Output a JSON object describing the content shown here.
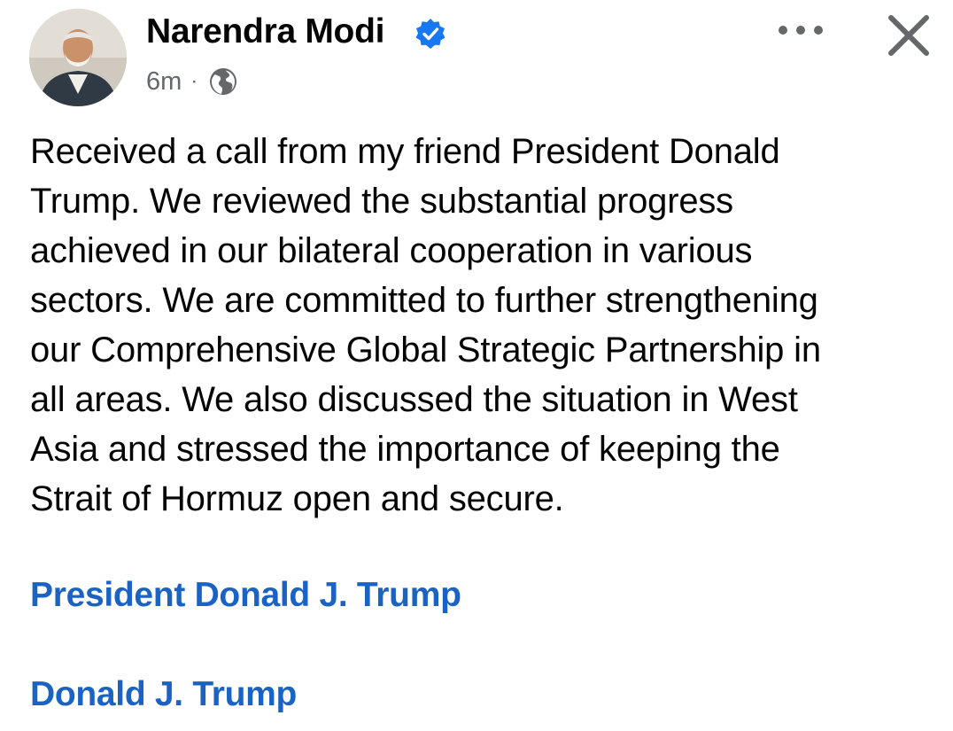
{
  "post": {
    "author": "Narendra Modi",
    "verified": true,
    "timestamp": "6m",
    "separator": "·",
    "audience_icon": "globe-icon",
    "menu_icon": "more-options-icon",
    "close_icon": "close-icon",
    "text_lines": [
      "Received a call from my friend President Donald",
      "Trump. We reviewed the substantial progress",
      "achieved in our bilateral cooperation in various",
      "sectors. We are committed to further strengthening",
      "our Comprehensive Global Strategic Partnership in",
      "all areas. We also discussed the situation in West",
      "Asia and stressed the importance of keeping the",
      "Strait of Hormuz open and secure."
    ],
    "tags": [
      "President Donald J. Trump",
      "Donald J. Trump"
    ]
  },
  "colors": {
    "text": "#050505",
    "secondary_text": "#65676b",
    "link": "#1b63c2",
    "verified_badge": "#1877f2",
    "background": "#ffffff"
  }
}
